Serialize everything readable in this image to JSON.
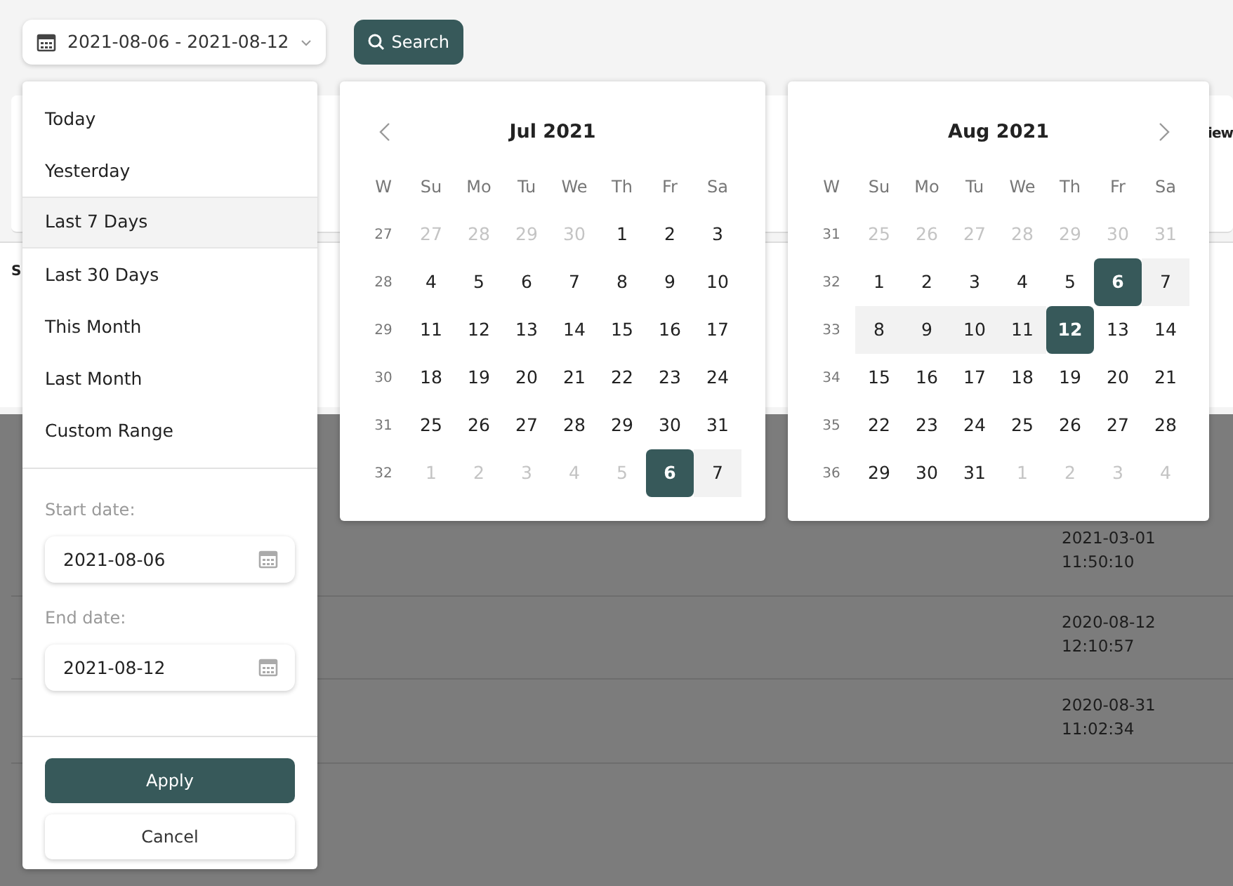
{
  "toolbar": {
    "date_range": "2021-08-06 - 2021-08-12",
    "search_button": "Search"
  },
  "background": {
    "header_fragment_left": "S",
    "header_fragment_right": "iew",
    "rows": [
      {
        "date_time": "2021-03-01 11:50:10"
      },
      {
        "date_time": "2020-08-12 12:10:57"
      },
      {
        "date_time": "2020-08-31 11:02:34"
      }
    ]
  },
  "ranges": [
    {
      "label": "Today",
      "selected": false
    },
    {
      "label": "Yesterday",
      "selected": false
    },
    {
      "label": "Last 7 Days",
      "selected": true
    },
    {
      "label": "Last 30 Days",
      "selected": false
    },
    {
      "label": "This Month",
      "selected": false
    },
    {
      "label": "Last Month",
      "selected": false
    },
    {
      "label": "Custom Range",
      "selected": false
    }
  ],
  "start_date": {
    "label": "Start date:",
    "value": "2021-08-06"
  },
  "end_date": {
    "label": "End date:",
    "value": "2021-08-12"
  },
  "buttons": [
    {
      "label": "Apply",
      "kind": "primary"
    },
    {
      "label": "Cancel",
      "kind": "secondary"
    }
  ],
  "calendars": [
    {
      "title": "Jul 2021",
      "prev_arrow": true,
      "next_arrow": false,
      "week_header": "W",
      "weekdays": [
        "Su",
        "Mo",
        "Tu",
        "We",
        "Th",
        "Fr",
        "Sa"
      ],
      "weeks": [
        {
          "week": "27",
          "days": [
            {
              "d": "27",
              "muted": true,
              "selected": false,
              "in_range": false
            },
            {
              "d": "28",
              "muted": true,
              "selected": false,
              "in_range": false
            },
            {
              "d": "29",
              "muted": true,
              "selected": false,
              "in_range": false
            },
            {
              "d": "30",
              "muted": true,
              "selected": false,
              "in_range": false
            },
            {
              "d": "1",
              "muted": false,
              "selected": false,
              "in_range": false
            },
            {
              "d": "2",
              "muted": false,
              "selected": false,
              "in_range": false
            },
            {
              "d": "3",
              "muted": false,
              "selected": false,
              "in_range": false
            }
          ]
        },
        {
          "week": "28",
          "days": [
            {
              "d": "4",
              "muted": false,
              "selected": false,
              "in_range": false
            },
            {
              "d": "5",
              "muted": false,
              "selected": false,
              "in_range": false
            },
            {
              "d": "6",
              "muted": false,
              "selected": false,
              "in_range": false
            },
            {
              "d": "7",
              "muted": false,
              "selected": false,
              "in_range": false
            },
            {
              "d": "8",
              "muted": false,
              "selected": false,
              "in_range": false
            },
            {
              "d": "9",
              "muted": false,
              "selected": false,
              "in_range": false
            },
            {
              "d": "10",
              "muted": false,
              "selected": false,
              "in_range": false
            }
          ]
        },
        {
          "week": "29",
          "days": [
            {
              "d": "11",
              "muted": false,
              "selected": false,
              "in_range": false
            },
            {
              "d": "12",
              "muted": false,
              "selected": false,
              "in_range": false
            },
            {
              "d": "13",
              "muted": false,
              "selected": false,
              "in_range": false
            },
            {
              "d": "14",
              "muted": false,
              "selected": false,
              "in_range": false
            },
            {
              "d": "15",
              "muted": false,
              "selected": false,
              "in_range": false
            },
            {
              "d": "16",
              "muted": false,
              "selected": false,
              "in_range": false
            },
            {
              "d": "17",
              "muted": false,
              "selected": false,
              "in_range": false
            }
          ]
        },
        {
          "week": "30",
          "days": [
            {
              "d": "18",
              "muted": false,
              "selected": false,
              "in_range": false
            },
            {
              "d": "19",
              "muted": false,
              "selected": false,
              "in_range": false
            },
            {
              "d": "20",
              "muted": false,
              "selected": false,
              "in_range": false
            },
            {
              "d": "21",
              "muted": false,
              "selected": false,
              "in_range": false
            },
            {
              "d": "22",
              "muted": false,
              "selected": false,
              "in_range": false
            },
            {
              "d": "23",
              "muted": false,
              "selected": false,
              "in_range": false
            },
            {
              "d": "24",
              "muted": false,
              "selected": false,
              "in_range": false
            }
          ]
        },
        {
          "week": "31",
          "days": [
            {
              "d": "25",
              "muted": false,
              "selected": false,
              "in_range": false
            },
            {
              "d": "26",
              "muted": false,
              "selected": false,
              "in_range": false
            },
            {
              "d": "27",
              "muted": false,
              "selected": false,
              "in_range": false
            },
            {
              "d": "28",
              "muted": false,
              "selected": false,
              "in_range": false
            },
            {
              "d": "29",
              "muted": false,
              "selected": false,
              "in_range": false
            },
            {
              "d": "30",
              "muted": false,
              "selected": false,
              "in_range": false
            },
            {
              "d": "31",
              "muted": false,
              "selected": false,
              "in_range": false
            }
          ]
        },
        {
          "week": "32",
          "days": [
            {
              "d": "1",
              "muted": true,
              "selected": false,
              "in_range": false
            },
            {
              "d": "2",
              "muted": true,
              "selected": false,
              "in_range": false
            },
            {
              "d": "3",
              "muted": true,
              "selected": false,
              "in_range": false
            },
            {
              "d": "4",
              "muted": true,
              "selected": false,
              "in_range": false
            },
            {
              "d": "5",
              "muted": true,
              "selected": false,
              "in_range": false
            },
            {
              "d": "6",
              "muted": false,
              "selected": true,
              "in_range": false
            },
            {
              "d": "7",
              "muted": false,
              "selected": false,
              "in_range": true
            }
          ]
        }
      ]
    },
    {
      "title": "Aug 2021",
      "prev_arrow": false,
      "next_arrow": true,
      "week_header": "W",
      "weekdays": [
        "Su",
        "Mo",
        "Tu",
        "We",
        "Th",
        "Fr",
        "Sa"
      ],
      "weeks": [
        {
          "week": "31",
          "days": [
            {
              "d": "25",
              "muted": true,
              "selected": false,
              "in_range": false
            },
            {
              "d": "26",
              "muted": true,
              "selected": false,
              "in_range": false
            },
            {
              "d": "27",
              "muted": true,
              "selected": false,
              "in_range": false
            },
            {
              "d": "28",
              "muted": true,
              "selected": false,
              "in_range": false
            },
            {
              "d": "29",
              "muted": true,
              "selected": false,
              "in_range": false
            },
            {
              "d": "30",
              "muted": true,
              "selected": false,
              "in_range": false
            },
            {
              "d": "31",
              "muted": true,
              "selected": false,
              "in_range": false
            }
          ]
        },
        {
          "week": "32",
          "days": [
            {
              "d": "1",
              "muted": false,
              "selected": false,
              "in_range": false
            },
            {
              "d": "2",
              "muted": false,
              "selected": false,
              "in_range": false
            },
            {
              "d": "3",
              "muted": false,
              "selected": false,
              "in_range": false
            },
            {
              "d": "4",
              "muted": false,
              "selected": false,
              "in_range": false
            },
            {
              "d": "5",
              "muted": false,
              "selected": false,
              "in_range": false
            },
            {
              "d": "6",
              "muted": false,
              "selected": true,
              "in_range": false
            },
            {
              "d": "7",
              "muted": false,
              "selected": false,
              "in_range": true
            }
          ]
        },
        {
          "week": "33",
          "days": [
            {
              "d": "8",
              "muted": false,
              "selected": false,
              "in_range": true
            },
            {
              "d": "9",
              "muted": false,
              "selected": false,
              "in_range": true
            },
            {
              "d": "10",
              "muted": false,
              "selected": false,
              "in_range": true
            },
            {
              "d": "11",
              "muted": false,
              "selected": false,
              "in_range": true
            },
            {
              "d": "12",
              "muted": false,
              "selected": true,
              "in_range": false
            },
            {
              "d": "13",
              "muted": false,
              "selected": false,
              "in_range": false
            },
            {
              "d": "14",
              "muted": false,
              "selected": false,
              "in_range": false
            }
          ]
        },
        {
          "week": "34",
          "days": [
            {
              "d": "15",
              "muted": false,
              "selected": false,
              "in_range": false
            },
            {
              "d": "16",
              "muted": false,
              "selected": false,
              "in_range": false
            },
            {
              "d": "17",
              "muted": false,
              "selected": false,
              "in_range": false
            },
            {
              "d": "18",
              "muted": false,
              "selected": false,
              "in_range": false
            },
            {
              "d": "19",
              "muted": false,
              "selected": false,
              "in_range": false
            },
            {
              "d": "20",
              "muted": false,
              "selected": false,
              "in_range": false
            },
            {
              "d": "21",
              "muted": false,
              "selected": false,
              "in_range": false
            }
          ]
        },
        {
          "week": "35",
          "days": [
            {
              "d": "22",
              "muted": false,
              "selected": false,
              "in_range": false
            },
            {
              "d": "23",
              "muted": false,
              "selected": false,
              "in_range": false
            },
            {
              "d": "24",
              "muted": false,
              "selected": false,
              "in_range": false
            },
            {
              "d": "25",
              "muted": false,
              "selected": false,
              "in_range": false
            },
            {
              "d": "26",
              "muted": false,
              "selected": false,
              "in_range": false
            },
            {
              "d": "27",
              "muted": false,
              "selected": false,
              "in_range": false
            },
            {
              "d": "28",
              "muted": false,
              "selected": false,
              "in_range": false
            }
          ]
        },
        {
          "week": "36",
          "days": [
            {
              "d": "29",
              "muted": false,
              "selected": false,
              "in_range": false
            },
            {
              "d": "30",
              "muted": false,
              "selected": false,
              "in_range": false
            },
            {
              "d": "31",
              "muted": false,
              "selected": false,
              "in_range": false
            },
            {
              "d": "1",
              "muted": true,
              "selected": false,
              "in_range": false
            },
            {
              "d": "2",
              "muted": true,
              "selected": false,
              "in_range": false
            },
            {
              "d": "3",
              "muted": true,
              "selected": false,
              "in_range": false
            },
            {
              "d": "4",
              "muted": true,
              "selected": false,
              "in_range": false
            }
          ]
        }
      ]
    }
  ]
}
